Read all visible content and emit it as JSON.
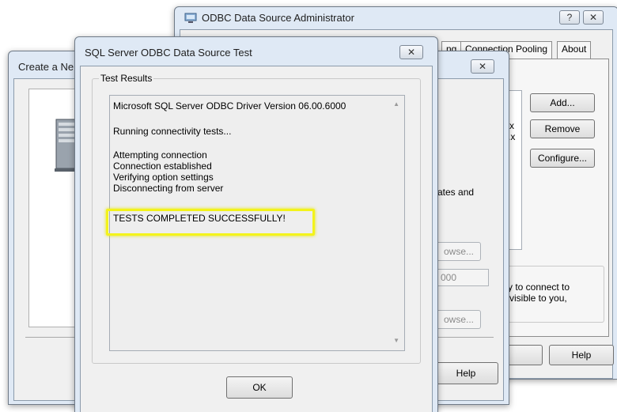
{
  "odbc_admin": {
    "title": "ODBC Data Source Administrator",
    "help_caption": "?",
    "close_caption": "✕",
    "tabs": [
      "ng",
      "Connection Pooling",
      "About"
    ],
    "buttons": {
      "add": "Add...",
      "remove": "Remove",
      "configure": "Configure...",
      "help": "Help"
    },
    "list_fragments": [
      "x",
      ".x"
    ],
    "desc_fragment_1": "y to connect to",
    "desc_fragment_2": "visible to you,"
  },
  "create_wizard": {
    "title": "Create a Ne",
    "close_caption": "✕",
    "text_fragment": "ates and",
    "browse_1": "owse...",
    "port_value": "000",
    "browse_2": "owse...",
    "help": "Help"
  },
  "test_dialog": {
    "title": "SQL Server ODBC Data Source Test",
    "close_caption": "✕",
    "group_label": "Test Results",
    "lines": [
      "Microsoft SQL Server ODBC Driver Version 06.00.6000",
      "Running connectivity tests...",
      "Attempting connection",
      "Connection established",
      "Verifying option settings",
      "Disconnecting from server",
      "TESTS COMPLETED SUCCESSFULLY!"
    ],
    "ok_label": "OK",
    "scroll_up": "▲",
    "scroll_down": "▼"
  },
  "colors": {
    "highlight": "#f3f31b",
    "title_bar": "#dfe9f5"
  }
}
